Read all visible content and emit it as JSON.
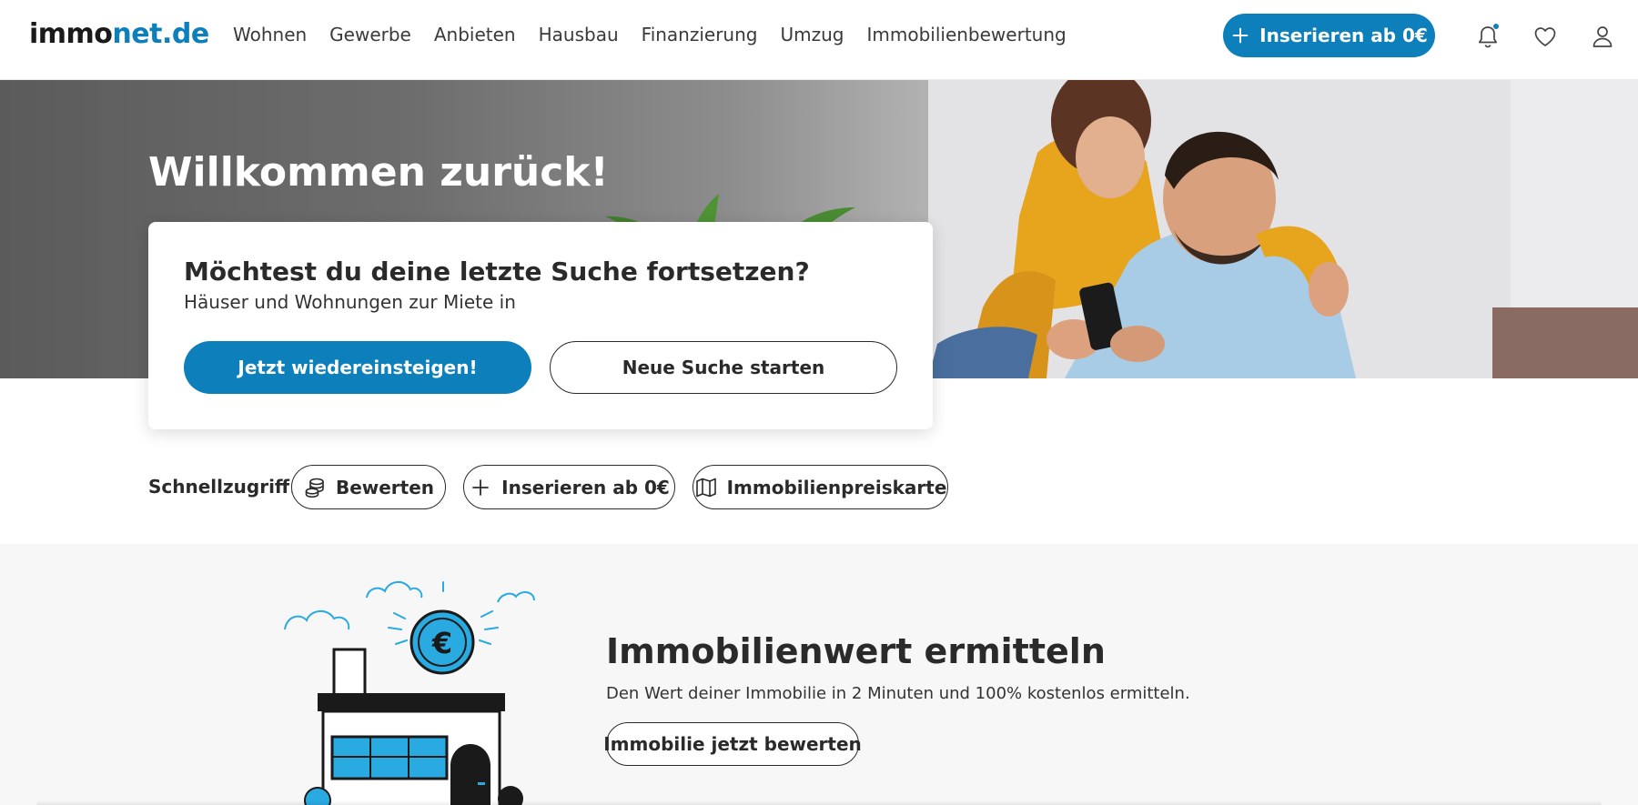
{
  "header": {
    "logo_part1": "immo",
    "logo_part2": "net",
    "logo_part3": ".de",
    "nav": [
      "Wohnen",
      "Gewerbe",
      "Anbieten",
      "Hausbau",
      "Finanzierung",
      "Umzug",
      "Immobilienbewertung"
    ],
    "cta_label": "Inserieren ab 0€",
    "icons": [
      "bell-icon",
      "heart-icon",
      "user-icon"
    ]
  },
  "hero": {
    "title": "Willkommen zurück!"
  },
  "card": {
    "title": "Möchtest du deine letzte Suche fortsetzen?",
    "subtitle": "Häuser und Wohnungen zur Miete in",
    "primary_label": "Jetzt wiedereinsteigen!",
    "secondary_label": "Neue Suche starten"
  },
  "quick": {
    "label": "Schnellzugriff:",
    "chips": [
      {
        "label": "Bewerten",
        "icon": "coins-icon"
      },
      {
        "label": "Inserieren ab 0€",
        "icon": "plus-icon"
      },
      {
        "label": "Immobilienpreiskarte",
        "icon": "map-icon"
      }
    ]
  },
  "valuation": {
    "title": "Immobilienwert ermitteln",
    "description": "Den Wert deiner Immobilie in 2 Minuten und 100% kostenlos ermitteln.",
    "button_label": "Immobilie jetzt bewerten",
    "coin_symbol": "€"
  },
  "colors": {
    "brand": "#0d7fbb",
    "text": "#2a2a2a"
  }
}
